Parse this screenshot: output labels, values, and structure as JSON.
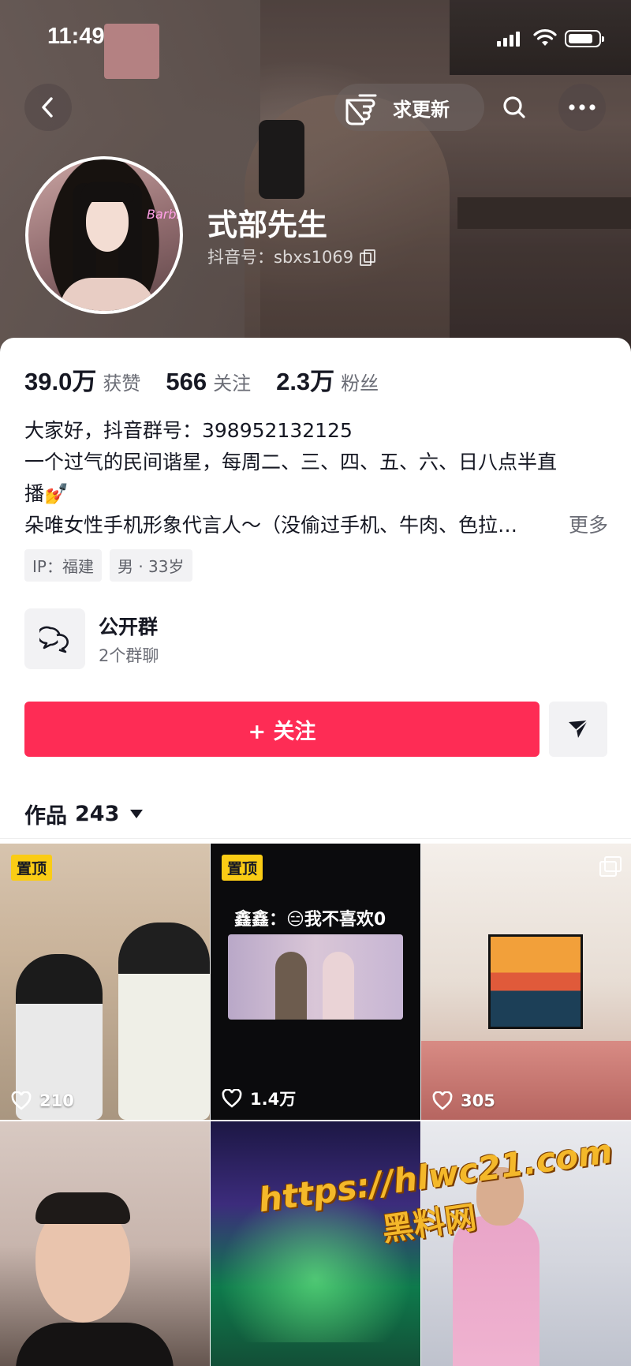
{
  "status_bar": {
    "time": "11:49"
  },
  "header": {
    "update_label": "求更新",
    "name": "式部先生",
    "douyin_id": "抖音号：sbxs1069",
    "avatar_neon_text": "Barbie"
  },
  "stats": {
    "likes_value": "39.0万",
    "likes_label": "获赞",
    "following_value": "566",
    "following_label": "关注",
    "fans_value": "2.3万",
    "fans_label": "粉丝"
  },
  "bio": {
    "line1": "大家好，抖音群号：398952132125",
    "line2": "一个过气的民间谐星，每周二、三、四、五、六、日八点半直",
    "line3": "播💅",
    "line4": "朵唯女性手机形象代言人～（没偷过手机、牛肉、色拉…",
    "more": "更多"
  },
  "tags": [
    "IP：福建",
    "男 · 33岁"
  ],
  "group": {
    "title": "公开群",
    "subtitle": "2个群聊"
  },
  "follow_button": "+ 关注",
  "works": {
    "label": "作品",
    "count": "243"
  },
  "videos": [
    {
      "pinned": "置顶",
      "likes": "210"
    },
    {
      "pinned": "置顶",
      "caption": "鑫鑫：😑我不喜欢0",
      "likes": "1.4万"
    },
    {
      "likes": "305",
      "multi_image": true
    },
    {
      "likes": ""
    },
    {
      "likes": ""
    },
    {
      "likes": ""
    }
  ],
  "watermark": {
    "url": "https://hlwc21.com",
    "site": "黑料网"
  },
  "colors": {
    "accent": "#fe2c55",
    "pin_badge": "#facc15"
  }
}
